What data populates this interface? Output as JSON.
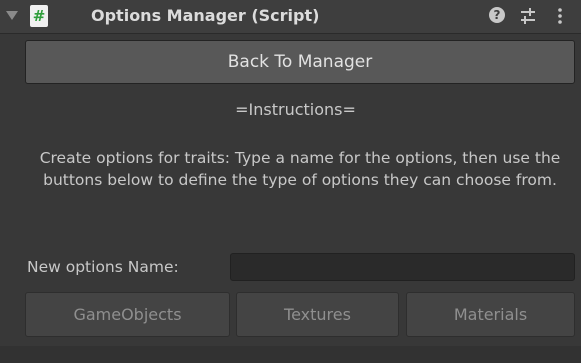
{
  "component": {
    "title": "Options Manager (Script)",
    "script_icon": "#",
    "icons": {
      "foldout": "foldout-arrow-icon",
      "script": "csharp-script-icon",
      "help": "help-icon",
      "presets": "presets-icon",
      "menu": "kebab-menu-icon"
    }
  },
  "back_button": {
    "label": "Back To Manager"
  },
  "instructions": {
    "title": "=Instructions=",
    "text": "Create options for traits: Type a name for the options, then use the buttons below to define the type of options they can choose from."
  },
  "new_options": {
    "label": "New options Name:",
    "value": "",
    "placeholder": ""
  },
  "option_buttons": [
    {
      "label": "GameObjects"
    },
    {
      "label": "Textures"
    },
    {
      "label": "Materials"
    }
  ],
  "colors": {
    "background": "#383838",
    "header": "#3e3e3e",
    "primary_button": "#585858",
    "secondary_button": "#444444",
    "input_background": "#2a2a2a",
    "script_icon_green": "#2e9e3a"
  }
}
